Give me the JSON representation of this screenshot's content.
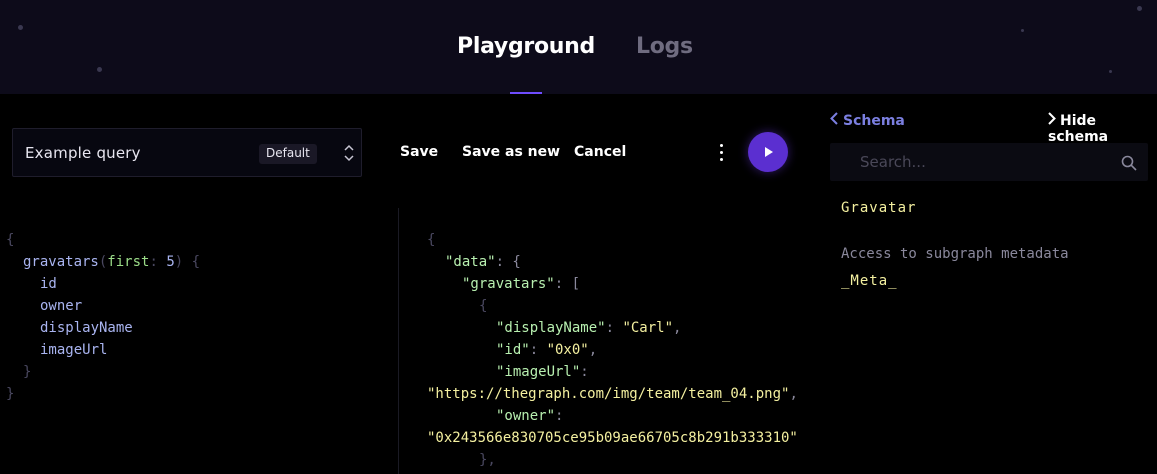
{
  "tabs": [
    {
      "label": "Playground",
      "active": true
    },
    {
      "label": "Logs",
      "active": false
    }
  ],
  "query_selector": {
    "name": "Example query",
    "badge": "Default"
  },
  "toolbar": {
    "save_label": "Save",
    "save_as_new_label": "Save as new",
    "cancel_label": "Cancel",
    "more_icon": "kebab-icon",
    "run_icon": "play-icon"
  },
  "query_editor": {
    "lines": [
      "{",
      "gravatars",
      "first",
      "5",
      "id",
      "owner",
      "displayName",
      "imageUrl",
      "}",
      "}"
    ]
  },
  "result": {
    "data_key": "\"data\"",
    "gravatars_key": "\"gravatars\"",
    "displayName_key": "\"displayName\"",
    "displayName_val": "\"Carl\"",
    "id_key": "\"id\"",
    "id_val": "\"0x0\"",
    "imageUrl_key": "\"imageUrl\"",
    "imageUrl_val": "\"https://thegraph.com/img/team/team_04.png\"",
    "owner_key": "\"owner\"",
    "owner_val": "\"0x243566e830705ce95b09ae66705c8b291b333310\""
  },
  "schema": {
    "back_label": "Schema",
    "hide_label": "Hide schema",
    "search_placeholder": "Search...",
    "type_name": "Gravatar",
    "meta_description": "Access to subgraph metadata",
    "meta_name": "_Meta_"
  },
  "colors": {
    "accent": "#6f4cff",
    "run_button": "#5b2fd0",
    "schema_link": "#7b7fe0",
    "string": "#f4f0a0"
  }
}
